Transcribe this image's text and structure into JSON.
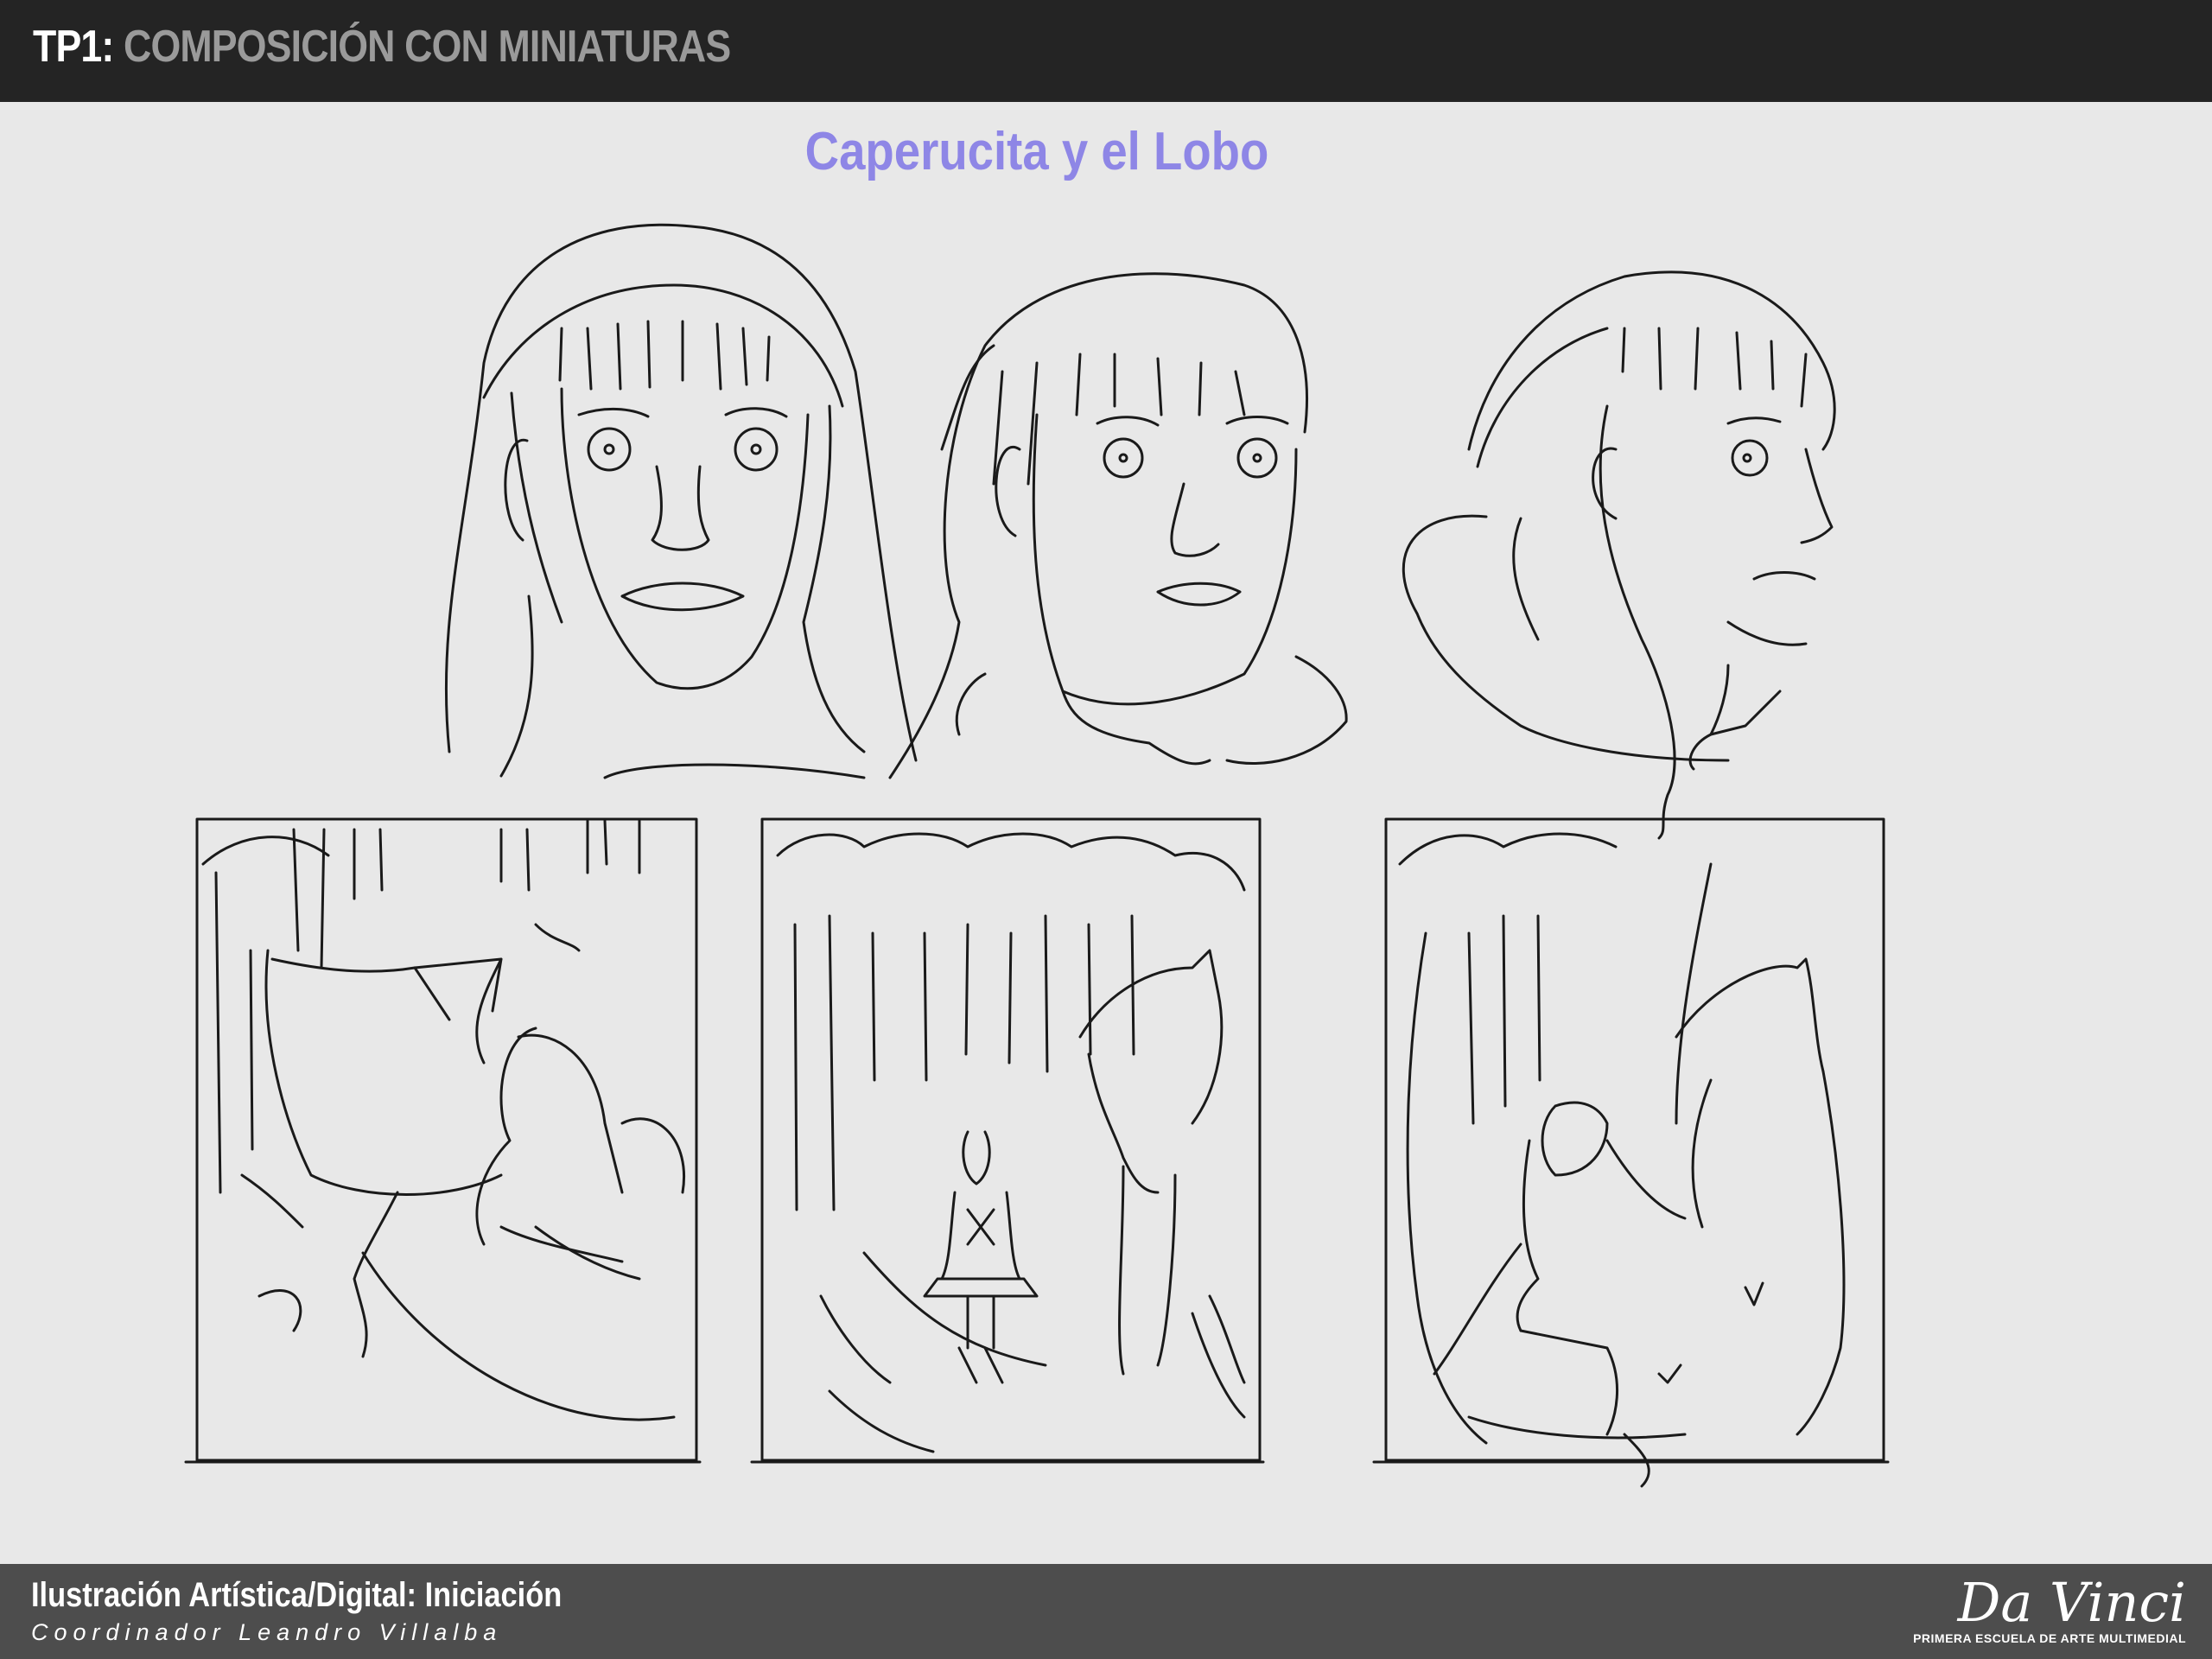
{
  "header": {
    "code": "TP1:",
    "subtitle": "COMPOSICIÓN CON MINIATURAS"
  },
  "artwork": {
    "title": "Caperucita y el Lobo"
  },
  "footer": {
    "course": "Ilustración Artística/Digital: Iniciación",
    "coordinator": "Coordinador Leandro Villalba",
    "logo_text": "Da Vinci",
    "logo_tagline": "PRIMERA ESCUELA DE ARTE MULTIMEDIAL"
  },
  "colors": {
    "header_bg": "#242424",
    "footer_bg": "#4d4d4d",
    "page_bg": "#e8e8e8",
    "title_accent": "#8e86e6"
  }
}
